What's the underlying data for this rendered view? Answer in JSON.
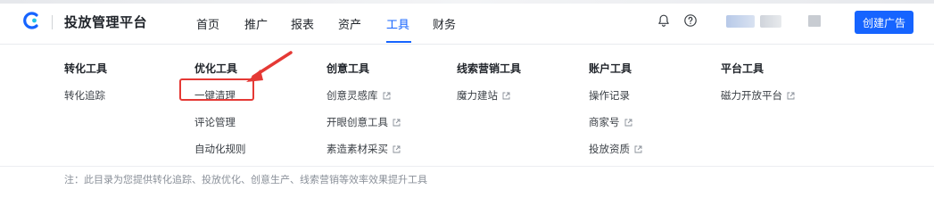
{
  "header": {
    "brand_title": "投放管理平台",
    "nav": [
      {
        "label": "首页"
      },
      {
        "label": "推广"
      },
      {
        "label": "报表"
      },
      {
        "label": "资产"
      },
      {
        "label": "工具",
        "active": true
      },
      {
        "label": "财务"
      }
    ],
    "cta_label": "创建广告",
    "accent_color": "#1664ff",
    "icons": [
      "bell-icon",
      "help-icon",
      "folder-icon"
    ]
  },
  "menu": {
    "columns": [
      {
        "title": "转化工具",
        "items": [
          {
            "label": "转化追踪",
            "external": false
          }
        ]
      },
      {
        "title": "优化工具",
        "items": [
          {
            "label": "一键清理",
            "external": false,
            "highlighted": true
          },
          {
            "label": "评论管理",
            "external": false
          },
          {
            "label": "自动化规则",
            "external": false
          }
        ]
      },
      {
        "title": "创意工具",
        "items": [
          {
            "label": "创意灵感库",
            "external": true
          },
          {
            "label": "开眼创意工具",
            "external": true
          },
          {
            "label": "素造素材采买",
            "external": true
          }
        ]
      },
      {
        "title": "线索营销工具",
        "items": [
          {
            "label": "魔力建站",
            "external": true
          }
        ]
      },
      {
        "title": "账户工具",
        "items": [
          {
            "label": "操作记录",
            "external": false
          },
          {
            "label": "商家号",
            "external": true
          },
          {
            "label": "投放资质",
            "external": true
          }
        ]
      },
      {
        "title": "平台工具",
        "items": [
          {
            "label": "磁力开放平台",
            "external": true
          }
        ]
      }
    ]
  },
  "footer": {
    "note": "注：此目录为您提供转化追踪、投放优化、创意生产、线索营销等效率效果提升工具"
  },
  "annotation_color": "#e53935"
}
